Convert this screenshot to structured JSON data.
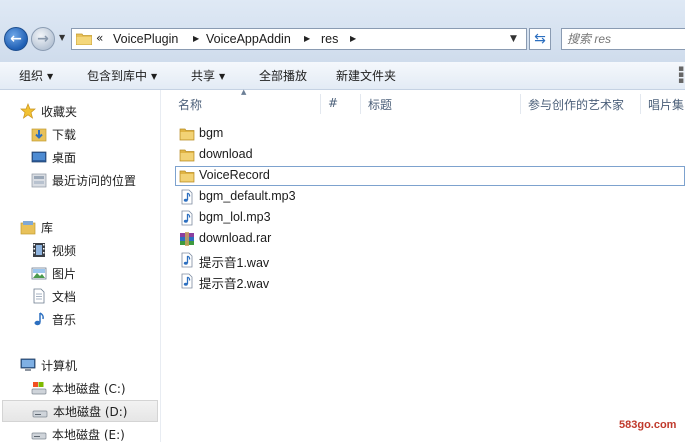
{
  "address": {
    "overflow": "«",
    "crumbs": [
      "VoicePlugin",
      "VoiceAppAddin",
      "res"
    ],
    "search_placeholder": "搜索 res"
  },
  "toolbar": {
    "organize": "组织",
    "include_in_library": "包含到库中",
    "share": "共享",
    "play_all": "全部播放",
    "new_folder": "新建文件夹"
  },
  "sidebar": {
    "favorites": "收藏夹",
    "downloads": "下载",
    "desktop": "桌面",
    "recent_places": "最近访问的位置",
    "libraries": "库",
    "videos": "视频",
    "pictures": "图片",
    "documents": "文档",
    "music": "音乐",
    "computer": "计算机",
    "drive_c": "本地磁盘 (C:)",
    "drive_d": "本地磁盘 (D:)",
    "drive_e": "本地磁盘 (E:)"
  },
  "columns": {
    "name": "名称",
    "number": "#",
    "title": "标题",
    "contributing_artists": "参与创作的艺术家",
    "album": "唱片集"
  },
  "files": [
    {
      "name": "bgm",
      "type": "folder"
    },
    {
      "name": "download",
      "type": "folder"
    },
    {
      "name": "VoiceRecord",
      "type": "folder"
    },
    {
      "name": "bgm_default.mp3",
      "type": "audio"
    },
    {
      "name": "bgm_lol.mp3",
      "type": "audio"
    },
    {
      "name": "download.rar",
      "type": "archive"
    },
    {
      "name": "提示音1.wav",
      "type": "audio"
    },
    {
      "name": "提示音2.wav",
      "type": "audio"
    }
  ],
  "watermark": "583go.com",
  "colors": {
    "folder": "#e8c15a",
    "accent": "#2c6fc0",
    "header_text": "#4c607a",
    "watermark": "#c0392b"
  }
}
